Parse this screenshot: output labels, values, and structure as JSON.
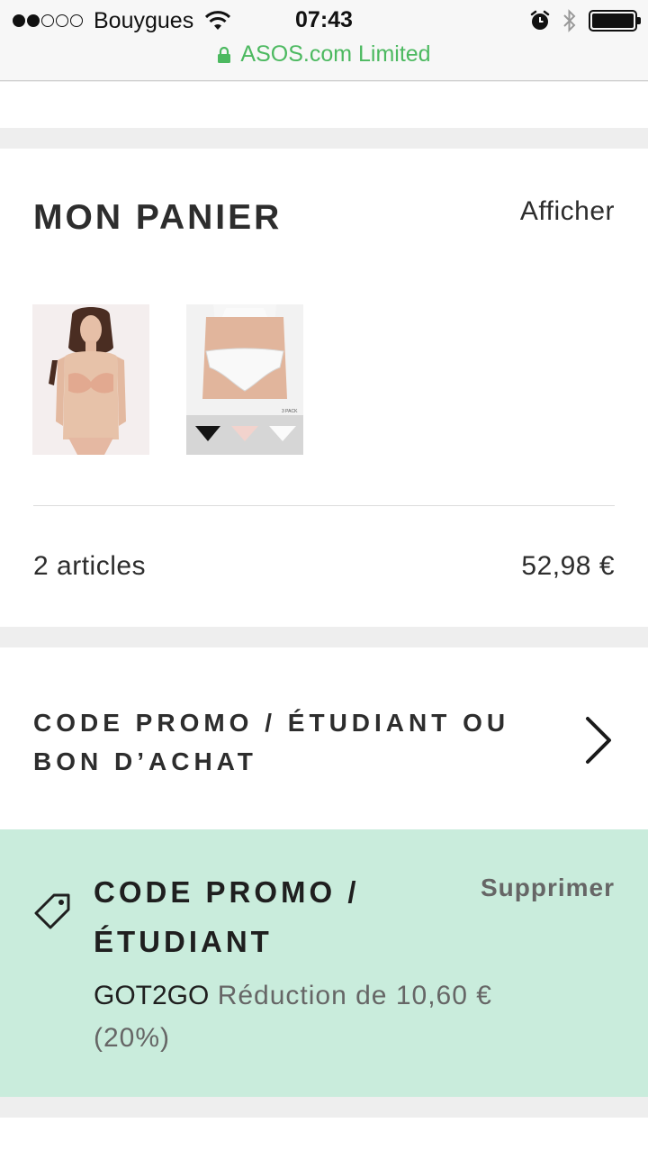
{
  "status_bar": {
    "carrier": "Bouygues",
    "signal_filled": 2,
    "signal_total": 5,
    "time": "07:43",
    "site_identity": "ASOS.com Limited",
    "site_identity_color": "#4cb960",
    "icons": [
      "wifi-icon",
      "alarm-icon",
      "bluetooth-icon",
      "battery-icon",
      "lock-icon"
    ]
  },
  "cart": {
    "title": "MON PANIER",
    "view_label": "Afficher",
    "items": [
      {
        "name": "bra-and-brief-set-thumbnail"
      },
      {
        "name": "three-pack-briefs-thumbnail",
        "badge": "3 PACK"
      }
    ],
    "count_label": "2 articles",
    "total": "52,98 €"
  },
  "promo_entry": {
    "label": "CODE PROMO / ÉTUDIANT OU BON D’ACHAT"
  },
  "applied_promo": {
    "title": "CODE PROMO / ÉTUDIANT",
    "remove_label": "Supprimer",
    "code": "GOT2GO",
    "description": "Réduction de 10,60 € (20%)",
    "background": "#c9ecdc"
  }
}
